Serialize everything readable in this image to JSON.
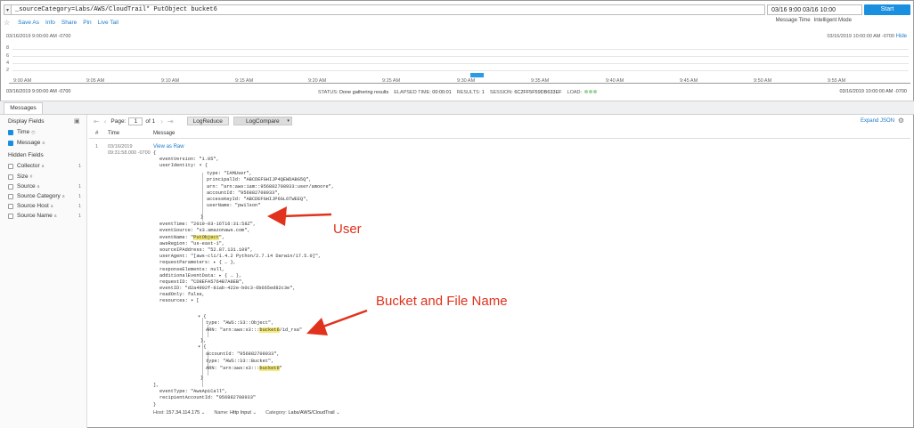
{
  "search": {
    "query": "_sourceCategory=Labs/AWS/CloudTrail* PutObject bucket6",
    "time_range": "03/16 9:00 03/16 10:00",
    "start_label": "Start",
    "dropdown_icon": "chevron-down-icon"
  },
  "toolbar": {
    "items": [
      "Save As",
      "Info",
      "Share",
      "Pin",
      "Live Tail"
    ],
    "message_time": "Message Time",
    "mode": "Intelligent Mode"
  },
  "histogram": {
    "range_start": "03/16/2019 9:00:00 AM -0700",
    "range_end": "03/16/2019 10:00:00 AM -0700",
    "hide_label": "Hide",
    "y_ticks": [
      "8",
      "6",
      "4",
      "2"
    ],
    "x_ticks": [
      "9:00 AM",
      "9:05 AM",
      "9:10 AM",
      "9:15 AM",
      "9:20 AM",
      "9:25 AM",
      "9:30 AM",
      "9:35 AM",
      "9:40 AM",
      "9:45 AM",
      "9:50 AM",
      "9:55 AM"
    ],
    "bar": {
      "time": "9:31 AM",
      "count": 1
    },
    "bar_color": "#2b9be8"
  },
  "status": {
    "left": "03/16/2019 9:00:00 AM -0700",
    "right": "03/16/2019 10:00:00 AM -0700",
    "status_label": "STATUS:",
    "status_value": "Done gathering results",
    "elapsed_label": "ELAPSED TIME:",
    "elapsed_value": "00:00:01",
    "results_label": "RESULTS:",
    "results_value": "1",
    "session_label": "SESSION:",
    "session_value": "6C2FF5F59DB633EF",
    "load_label": "LOAD:"
  },
  "tabs": {
    "messages": "Messages"
  },
  "fields": {
    "display_title": "Display Fields",
    "display": [
      {
        "label": "Time",
        "checked": true
      },
      {
        "label": "Message",
        "checked": true
      }
    ],
    "hidden_title": "Hidden Fields",
    "hidden": [
      {
        "label": "Collector",
        "count": "1"
      },
      {
        "label": "Size",
        "count": ""
      },
      {
        "label": "Source",
        "count": "1"
      },
      {
        "label": "Source Category",
        "count": "1"
      },
      {
        "label": "Source Host",
        "count": "1"
      },
      {
        "label": "Source Name",
        "count": "1"
      }
    ]
  },
  "pager": {
    "page_label": "Page:",
    "page_value": "1",
    "of_label": "of 1",
    "logreduce": "LogReduce",
    "logcompare": "LogCompare",
    "expand_json": "Expand JSON"
  },
  "columns": {
    "num": "#",
    "time": "Time",
    "message": "Message"
  },
  "message": {
    "row": "1",
    "date": "03/16/2019",
    "time": "09:31:58.000 -0700",
    "view_raw": "View as Raw",
    "lines": {
      "l0": "{",
      "l1": "eventVersion: \"1.05\",",
      "l2": "userIdentity: ▾ {",
      "l3": "type: \"IAMUser\",",
      "l4": "principalId: \"ABCDEFGHIJP4QEWDABG5Q\",",
      "l5": "arn: \"arn:aws:iam::956882708933:user/amoore\",",
      "l6": "accountId: \"956882708933\",",
      "l7": "accessKeyId: \"ABCDEFGHIJP6GL6TWEEQ\",",
      "l8": "userName: \"pwilson\"",
      "l9": "}",
      "l10": "eventTime: \"2019-03-16T16:31:58Z\",",
      "l11": "eventSource: \"s3.amazonaws.com\",",
      "l12a": "eventName: \"",
      "l12b": "PutObject",
      "l12c": "\",",
      "l13": "awsRegion: \"us-east-1\",",
      "l14": "sourceIPAddress: \"52.87.131.109\",",
      "l15": "userAgent: \"[aws-cli/1.4.2 Python/2.7.14 Darwin/17.5.0]\",",
      "l16": "requestParameters: ▸ { … },",
      "l17": "responseElements: null,",
      "l18": "additionalEventData: ▸ { … },",
      "l19": "requestID: \"CD8EFA5764B7A8EB\",",
      "l20": "eventID: \"d2a4902f-81ab-422e-b0c3-6b665ed82c3e\",",
      "l21": "readOnly: false,",
      "l22": "resources: ▾ [",
      "l23": "▾ {",
      "l24": "type: \"AWS::S3::Object\",",
      "l25a": "ARN: \"arn:aws:s3:::",
      "l25b": "bucket6",
      "l25c": "/id_rsa\"",
      "l26": "},",
      "l27": "▾ {",
      "l28": "accountId: \"956882708933\",",
      "l29": "type: \"AWS::S3::Bucket\",",
      "l30a": "ARN: \"arn:aws:s3:::",
      "l30b": "bucket6",
      "l30c": "\"",
      "l31": "}",
      "l32": "],",
      "l33": "eventType: \"AwsApiCall\",",
      "l34": "recipientAccountId: \"956882708933\"",
      "l35": "}"
    },
    "footer": {
      "host_label": "Host:",
      "host": "157.34.114.175",
      "name_label": "Name:",
      "name": "Http Input",
      "category_label": "Category:",
      "category": "Labs/AWS/CloudTrail"
    }
  },
  "annotations": {
    "user": "User",
    "bucket": "Bucket and File Name",
    "color": "#e0321c"
  }
}
